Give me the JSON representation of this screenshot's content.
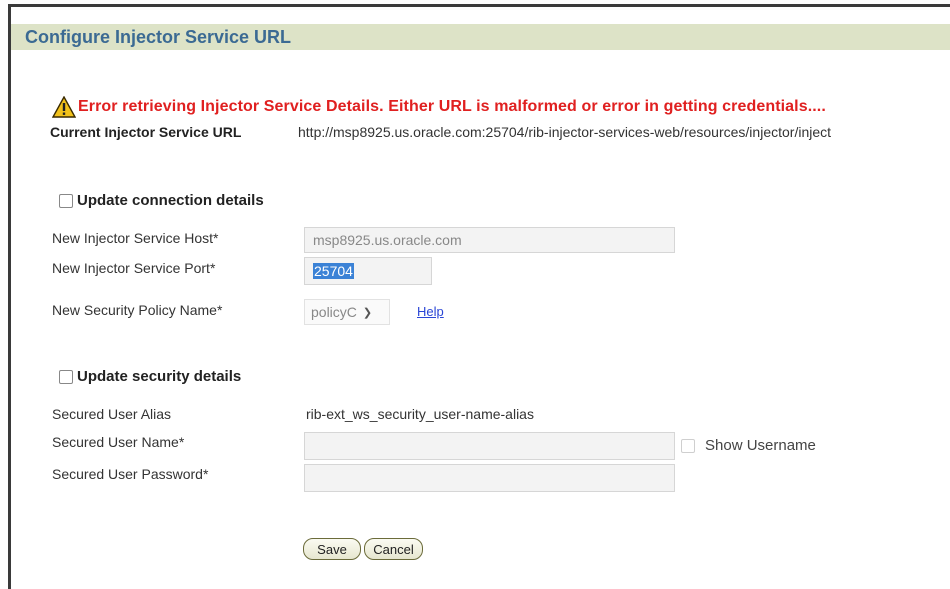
{
  "header": {
    "title": "Configure Injector Service URL"
  },
  "error": {
    "message": "Error retrieving Injector Service Details. Either URL is malformed or error in getting credentials...."
  },
  "current": {
    "label": "Current Injector Service URL",
    "value": "http://msp8925.us.oracle.com:25704/rib-injector-services-web/resources/injector/inject"
  },
  "connection": {
    "checkbox_label": "Update connection details",
    "host_label": "New Injector Service Host*",
    "host_value": "msp8925.us.oracle.com",
    "port_label": "New Injector Service Port*",
    "port_value": "25704",
    "policy_label": "New Security Policy Name*",
    "policy_value": "policyC",
    "help_link": "Help"
  },
  "security": {
    "checkbox_label": "Update security details",
    "alias_label": "Secured User Alias",
    "alias_value": "rib-ext_ws_security_user-name-alias",
    "username_label": "Secured User Name*",
    "username_value": "",
    "password_label": "Secured User Password*",
    "password_value": "",
    "show_username_label": "Show Username"
  },
  "actions": {
    "save_label": "Save",
    "cancel_label": "Cancel"
  },
  "colors": {
    "title_bg": "#dde3c7",
    "title_text": "#3b6a93",
    "error_text": "#e02020",
    "link": "#2a46d6"
  }
}
